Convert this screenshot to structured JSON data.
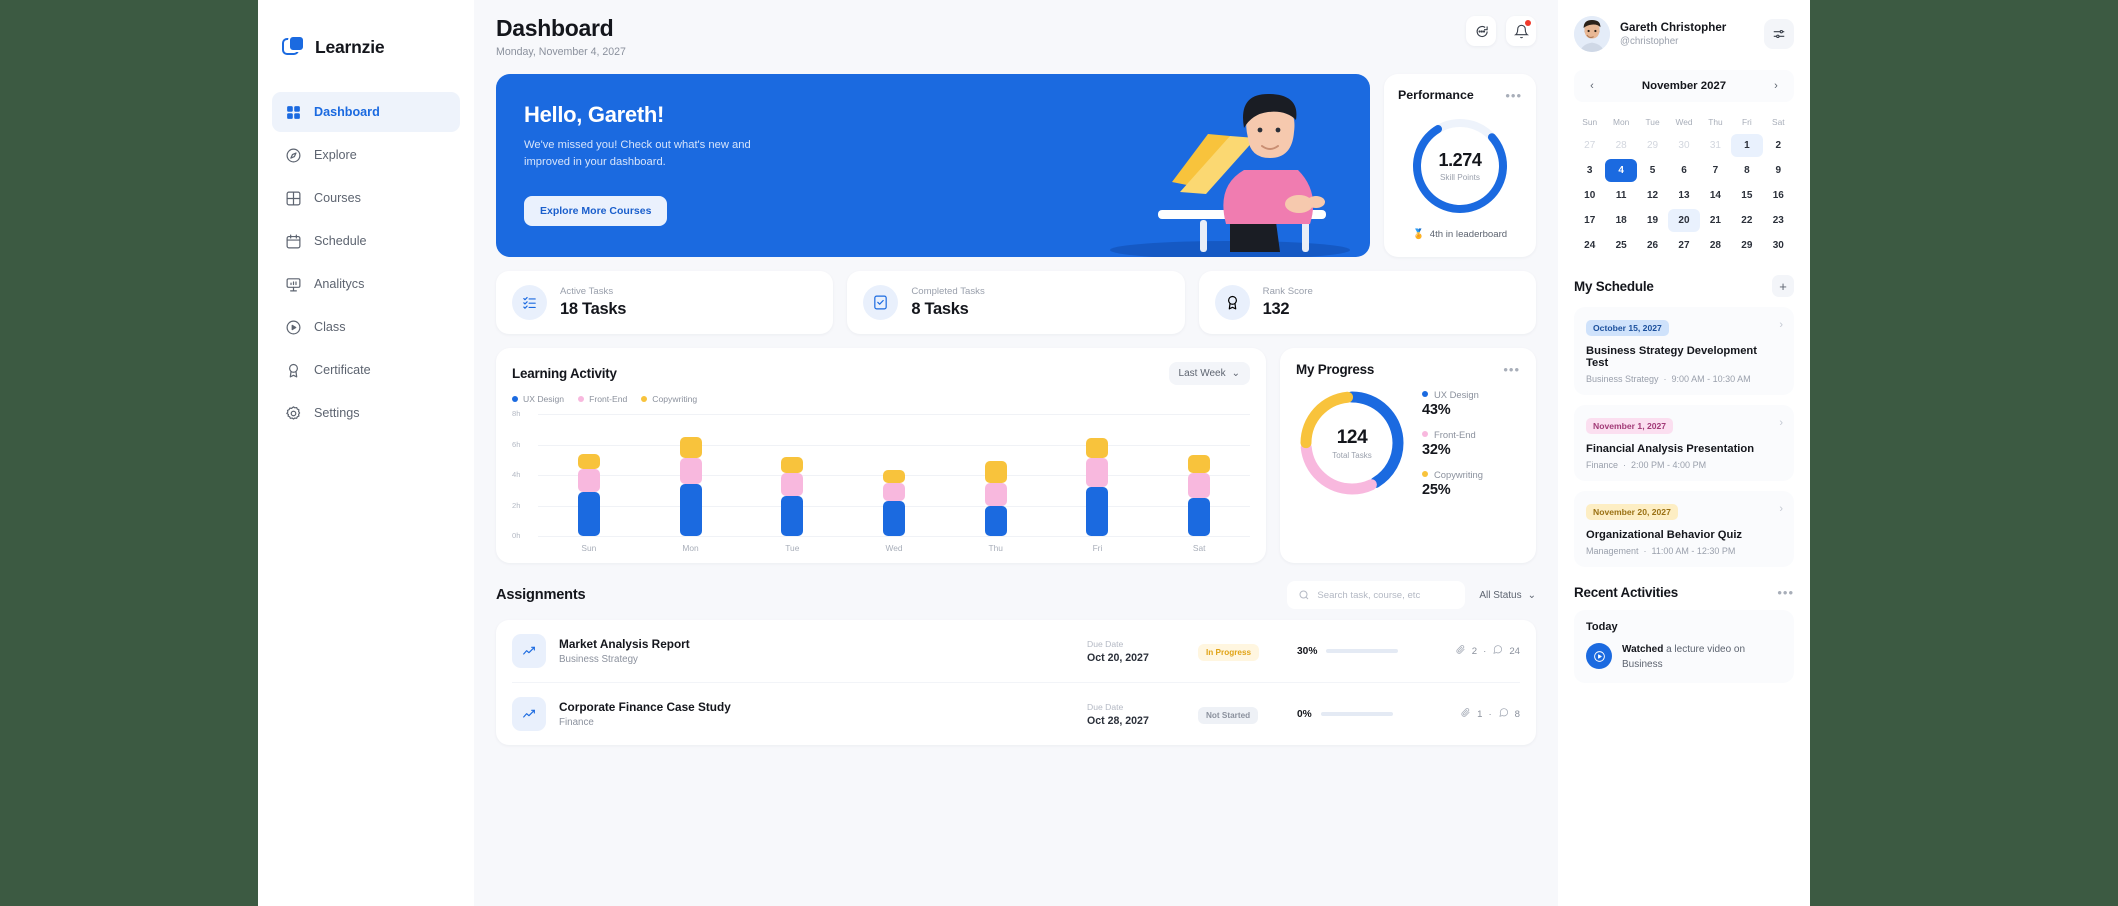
{
  "brand": {
    "name": "Learnzie"
  },
  "sidebar": {
    "items": [
      {
        "label": "Dashboard",
        "icon": "grid-icon",
        "active": true
      },
      {
        "label": "Explore",
        "icon": "compass-icon",
        "active": false
      },
      {
        "label": "Courses",
        "icon": "courses-grid-icon",
        "active": false
      },
      {
        "label": "Schedule",
        "icon": "calendar-icon",
        "active": false
      },
      {
        "label": "Analitycs",
        "icon": "analytics-icon",
        "active": false
      },
      {
        "label": "Class",
        "icon": "play-circle-icon",
        "active": false
      },
      {
        "label": "Certificate",
        "icon": "award-icon",
        "active": false
      },
      {
        "label": "Settings",
        "icon": "gear-icon",
        "active": false
      }
    ]
  },
  "header": {
    "title": "Dashboard",
    "date": "Monday, November 4, 2027",
    "chat_icon": "chat-icon",
    "bell_icon": "bell-icon"
  },
  "hero": {
    "greeting": "Hello, Gareth!",
    "message": "We've missed you! Check out what's new and improved in your dashboard.",
    "cta": "Explore More Courses"
  },
  "performance": {
    "title": "Performance",
    "value": "1.274",
    "label": "Skill Points",
    "footer": "4th in leaderboard",
    "medal_icon": "medal-icon",
    "percent": 78,
    "color": "#1b6ae0"
  },
  "stats": [
    {
      "label": "Active Tasks",
      "value": "18 Tasks",
      "icon": "checklist-icon"
    },
    {
      "label": "Completed Tasks",
      "value": "8 Tasks",
      "icon": "check-square-icon"
    },
    {
      "label": "Rank Score",
      "value": "132",
      "icon": "award-icon"
    }
  ],
  "learning_activity": {
    "title": "Learning Activity",
    "range": "Last Week"
  },
  "my_progress": {
    "title": "My Progress",
    "total": "124",
    "total_label": "Total Tasks"
  },
  "assignments": {
    "title": "Assignments",
    "search_placeholder": "Search task, course, etc",
    "search_value": "",
    "status_filter": "All Status",
    "due_label": "Due Date",
    "rows": [
      {
        "name": "Market Analysis Report",
        "course": "Business Strategy",
        "due": "Oct 20, 2027",
        "status": "In Progress",
        "status_bg": "#fff6e0",
        "status_fg": "#e0a316",
        "progress": "30%",
        "progress_pct": 30,
        "attachments": "2",
        "comments": "24",
        "icon": "chart-line-icon"
      },
      {
        "name": "Corporate Finance Case Study",
        "course": "Finance",
        "due": "Oct 28, 2027",
        "status": "Not Started",
        "status_bg": "#eef1f6",
        "status_fg": "#8b919d",
        "progress": "0%",
        "progress_pct": 0,
        "attachments": "1",
        "comments": "8",
        "icon": "chart-line-icon"
      }
    ]
  },
  "profile": {
    "name": "Gareth Christopher",
    "handle": "@christopher",
    "settings_icon": "sliders-icon"
  },
  "calendar": {
    "month": "November 2027",
    "prev_icon": "chevron-left-icon",
    "next_icon": "chevron-right-icon",
    "dow": [
      "Sun",
      "Mon",
      "Tue",
      "Wed",
      "Thu",
      "Fri",
      "Sat"
    ],
    "days": [
      {
        "n": "27",
        "state": "mut"
      },
      {
        "n": "28",
        "state": "mut"
      },
      {
        "n": "29",
        "state": "mut"
      },
      {
        "n": "30",
        "state": "mut"
      },
      {
        "n": "31",
        "state": "mut"
      },
      {
        "n": "1",
        "state": "hl"
      },
      {
        "n": "2",
        "state": ""
      },
      {
        "n": "3",
        "state": ""
      },
      {
        "n": "4",
        "state": "sel"
      },
      {
        "n": "5",
        "state": ""
      },
      {
        "n": "6",
        "state": ""
      },
      {
        "n": "7",
        "state": ""
      },
      {
        "n": "8",
        "state": ""
      },
      {
        "n": "9",
        "state": ""
      },
      {
        "n": "10",
        "state": ""
      },
      {
        "n": "11",
        "state": ""
      },
      {
        "n": "12",
        "state": ""
      },
      {
        "n": "13",
        "state": ""
      },
      {
        "n": "14",
        "state": ""
      },
      {
        "n": "15",
        "state": ""
      },
      {
        "n": "16",
        "state": ""
      },
      {
        "n": "17",
        "state": ""
      },
      {
        "n": "18",
        "state": ""
      },
      {
        "n": "19",
        "state": ""
      },
      {
        "n": "20",
        "state": "hl"
      },
      {
        "n": "21",
        "state": ""
      },
      {
        "n": "22",
        "state": ""
      },
      {
        "n": "23",
        "state": ""
      },
      {
        "n": "24",
        "state": ""
      },
      {
        "n": "25",
        "state": ""
      },
      {
        "n": "26",
        "state": ""
      },
      {
        "n": "27",
        "state": ""
      },
      {
        "n": "28",
        "state": ""
      },
      {
        "n": "29",
        "state": ""
      },
      {
        "n": "30",
        "state": ""
      }
    ]
  },
  "schedule": {
    "title": "My Schedule",
    "add_icon": "plus-icon",
    "items": [
      {
        "date": "October 15, 2027",
        "chip_bg": "#cfe2fb",
        "chip_fg": "#1b4f9c",
        "title": "Business Strategy Development Test",
        "course": "Business Strategy",
        "time": "9:00 AM - 10:30 AM"
      },
      {
        "date": "November 1, 2027",
        "chip_bg": "#fbdff0",
        "chip_fg": "#a23a77",
        "title": "Financial Analysis Presentation",
        "course": "Finance",
        "time": "2:00 PM - 4:00 PM"
      },
      {
        "date": "November 20, 2027",
        "chip_bg": "#fdeec4",
        "chip_fg": "#9a7114",
        "title": "Organizational Behavior Quiz",
        "course": "Management",
        "time": "11:00 AM - 12:30 PM"
      }
    ]
  },
  "recent_activities": {
    "title": "Recent Activities",
    "day": "Today",
    "items": [
      {
        "action": "Watched",
        "rest": "a lecture video on Business",
        "icon": "play-circle-icon"
      }
    ]
  },
  "chart_data": [
    {
      "type": "bar",
      "title": "Learning Activity",
      "stacked": true,
      "categories": [
        "Sun",
        "Mon",
        "Tue",
        "Wed",
        "Thu",
        "Fri",
        "Sat"
      ],
      "series": [
        {
          "name": "UX Design",
          "color": "#1b6ae0",
          "values": [
            2.9,
            3.4,
            2.6,
            2.3,
            2.0,
            3.2,
            2.5
          ]
        },
        {
          "name": "Front-End",
          "color": "#f8b8de",
          "values": [
            1.5,
            1.7,
            1.5,
            1.2,
            1.5,
            1.9,
            1.6
          ]
        },
        {
          "name": "Copywriting",
          "color": "#f8c33c",
          "values": [
            1.0,
            1.4,
            1.1,
            0.8,
            1.4,
            1.3,
            1.2
          ]
        }
      ],
      "xlabel": "",
      "ylabel": "",
      "ylim": [
        0,
        8
      ],
      "yticks": [
        "0h",
        "2h",
        "4h",
        "6h",
        "8h"
      ],
      "grid": true,
      "legend": "top-left"
    },
    {
      "type": "pie",
      "title": "My Progress",
      "donut": true,
      "center_value": "124",
      "center_label": "Total Tasks",
      "labels": [
        "UX Design",
        "Front-End",
        "Copywriting"
      ],
      "values": [
        43,
        32,
        25
      ],
      "display_values": [
        "43%",
        "32%",
        "25%"
      ],
      "colors": [
        "#1b6ae0",
        "#f8b8de",
        "#f8c33c"
      ],
      "legend": "right"
    }
  ]
}
